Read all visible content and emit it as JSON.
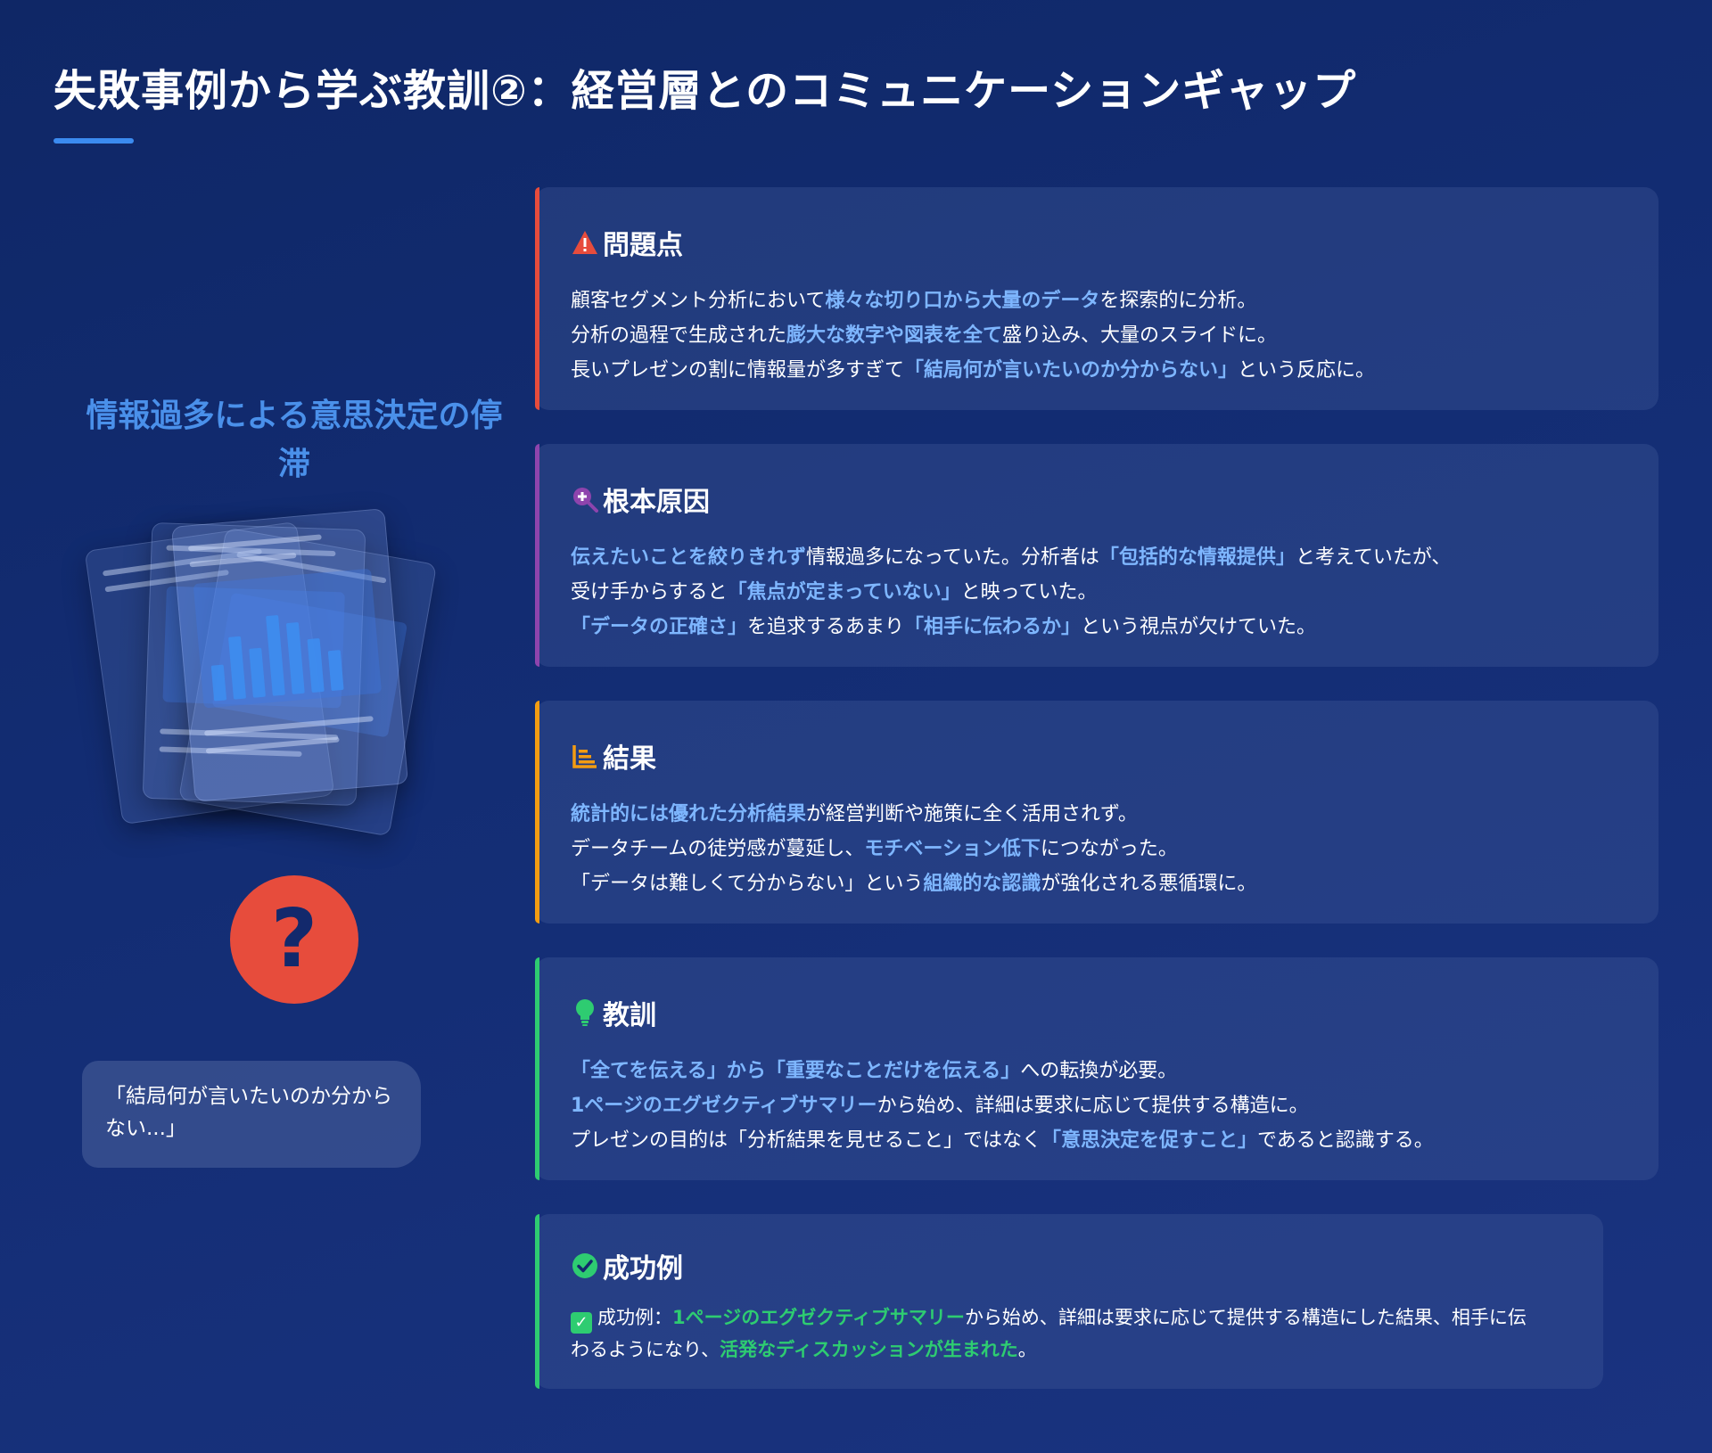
{
  "page": {
    "title": "失敗事例から学ぶ教訓②：経営層とのコミュニケーションギャップ"
  },
  "left": {
    "heading": "情報過多による意思決定の停滞",
    "question_mark": "?",
    "quote": "「結局何が言いたいのか分からない...」"
  },
  "cards": {
    "problem": {
      "title": "問題点",
      "icon": "warning-icon",
      "accent": "#e74c3c",
      "lines": [
        [
          "顧客セグメント分析において",
          "様々な切り口から大量のデータ",
          "を探索的に分析。"
        ],
        [
          "分析の過程で生成された",
          "膨大な数字や図表を全て",
          "盛り込み、大量のスライドに。"
        ],
        [
          "長いプレゼンの割に情報量が多すぎて",
          "「結局何が言いたいのか分からない」",
          "という反応に。"
        ]
      ]
    },
    "cause": {
      "title": "根本原因",
      "icon": "magnifier-icon",
      "accent": "#8e44ad",
      "line1": [
        "",
        "伝えたいことを絞りきれず",
        "情報過多になっていた。分析者は",
        "「包括的な情報提供」",
        "と考えていたが、"
      ],
      "line2": [
        "受け手からすると",
        "「焦点が定まっていない」",
        "と映っていた。"
      ],
      "line3": [
        "「データの正確さ」",
        "を追求するあまり",
        "「相手に伝わるか」",
        "という視点が欠けていた。"
      ]
    },
    "result": {
      "title": "結果",
      "icon": "chart-icon",
      "accent": "#f39c12",
      "line1": [
        "統計的には優れた分析結果",
        "が経営判断や施策に全く活用されず。"
      ],
      "line2": [
        "データチームの徒労感が蔓延し、",
        "モチベーション低下",
        "につながった。"
      ],
      "line3": [
        "「データは難しくて分からない」という",
        "組織的な認識",
        "が強化される悪循環に。"
      ]
    },
    "lesson": {
      "title": "教訓",
      "icon": "lightbulb-icon",
      "accent": "#2ecc71",
      "line1": [
        "「全てを伝える」から「重要なことだけを伝える」",
        "への転換が必要。"
      ],
      "line2": [
        "1ページのエグゼクティブサマリー",
        "から始め、詳細は要求に応じて提供する構造に。"
      ],
      "line3": [
        "プレゼンの目的は「分析結果を見せること」ではなく",
        "「意思決定を促すこと」",
        "であると認識する。"
      ]
    },
    "success": {
      "title": "成功例",
      "icon": "check-circle-icon",
      "accent": "#2ecc71",
      "check": "✓",
      "parts": [
        "成功例：",
        "1ページのエグゼクティブサマリー",
        "から始め、詳細は要求に応じて提供する構造にした結果、相手に伝わるようになり、",
        "活発なディスカッションが生まれた",
        "。"
      ]
    }
  },
  "colors": {
    "background": "#132d74",
    "highlight": "#7eb6ff",
    "highlight_green": "#2ecc71",
    "accent_blue": "#3b8bf0"
  }
}
